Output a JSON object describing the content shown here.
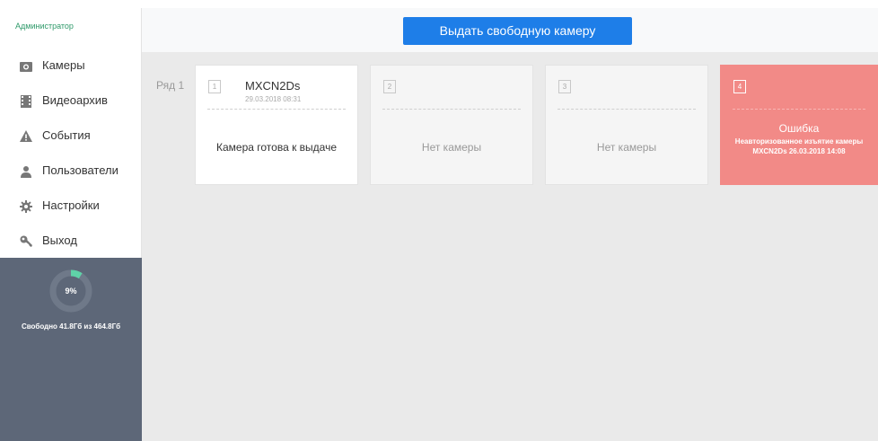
{
  "sidebar": {
    "role": "Администратор",
    "items": [
      {
        "label": "Камеры",
        "icon": "camera-icon"
      },
      {
        "label": "Видеоархив",
        "icon": "film-icon"
      },
      {
        "label": "События",
        "icon": "warning-icon"
      },
      {
        "label": "Пользователи",
        "icon": "user-icon"
      },
      {
        "label": "Настройки",
        "icon": "gear-icon"
      },
      {
        "label": "Выход",
        "icon": "key-icon"
      }
    ],
    "storage": {
      "percent_label": "9%",
      "percent": 9,
      "free_text": "Свободно 41.8Гб из 464.8Гб"
    }
  },
  "header": {
    "issue_button_label": "Выдать свободную камеру"
  },
  "grid": {
    "row_label": "Ряд 1",
    "cells": [
      {
        "number": "1",
        "camera_name": "MXCN2Ds",
        "camera_date": "29.03.2018 08:31",
        "status": "Камера готова к выдаче"
      },
      {
        "number": "2",
        "status": "Нет камеры"
      },
      {
        "number": "3",
        "status": "Нет камеры"
      },
      {
        "number": "4",
        "error_title": "Ошибка",
        "error_text": "Неавторизованное изъятие камеры MXCN2Ds 26.03.2018 14:08"
      }
    ]
  },
  "colors": {
    "accent": "#1e7ee8",
    "error": "#f28a87",
    "sidebar_storage_bg": "#5d6778",
    "role_text": "#2f9a6a",
    "ring_fill": "#5fd3a8"
  }
}
